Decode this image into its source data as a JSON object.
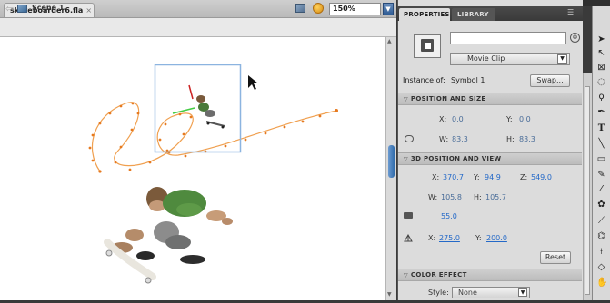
{
  "document": {
    "tab_title": "skateboarder6.fla",
    "tab_close": "×",
    "scene_label": "Scene 1",
    "zoom": "150%"
  },
  "panel": {
    "tabs": [
      "PROPERTIES",
      "LIBRARY"
    ],
    "instance_name_value": "",
    "symbol_type": "Movie Clip",
    "instance_of_label": "Instance of:",
    "instance_of_value": "Symbol 1",
    "swap_label": "Swap...",
    "position_size": {
      "title": "POSITION AND SIZE",
      "x_label": "X:",
      "x_value": "0.0",
      "y_label": "Y:",
      "y_value": "0.0",
      "w_label": "W:",
      "w_value": "83.3",
      "h_label": "H:",
      "h_value": "83.3"
    },
    "position_3d": {
      "title": "3D POSITION AND VIEW",
      "x_label": "X:",
      "x_value": "370.7",
      "y_label": "Y:",
      "y_value": "94.9",
      "z_label": "Z:",
      "z_value": "549.0",
      "w_label": "W:",
      "w_value": "105.8",
      "h_label": "H:",
      "h_value": "105.7",
      "perspective_value": "55.0",
      "vanish_x_label": "X:",
      "vanish_x_value": "275.0",
      "vanish_y_label": "Y:",
      "vanish_y_value": "200.0",
      "reset_label": "Reset"
    },
    "color_effect": {
      "title": "COLOR EFFECT",
      "style_label": "Style:",
      "style_value": "None"
    }
  },
  "colors": {
    "motion_path": "#f0a050",
    "selection": "#8cb4e0",
    "link_value": "#2469c8"
  }
}
